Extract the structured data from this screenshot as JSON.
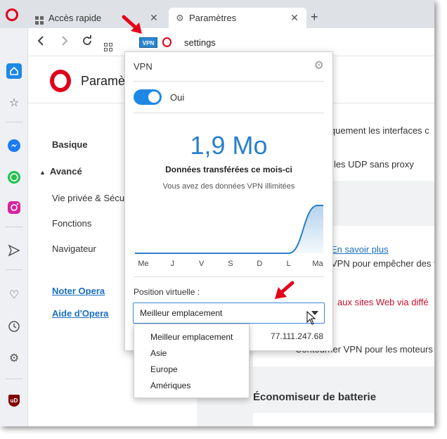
{
  "tabs": [
    {
      "title": "Accès rapide",
      "icon": "grid-icon"
    },
    {
      "title": "Paramètres",
      "icon": "gear-icon"
    }
  ],
  "address": {
    "vpn_badge": "VPN",
    "url": "settings"
  },
  "sidebar": {
    "items": [
      "home-icon",
      "star-icon",
      "messenger-icon",
      "whatsapp-icon",
      "instagram-icon",
      "send-icon",
      "heart-icon",
      "clock-icon",
      "gear-icon",
      "ublock-icon"
    ],
    "ublock_label": "uD"
  },
  "settings": {
    "title": "Paramèt",
    "nav": {
      "basic": "Basique",
      "advanced": "Avancé",
      "privacy": "Vie privée & Sécu",
      "features": "Fonctions",
      "browser": "Navigateur",
      "rate": "Noter Opera",
      "help": "Aide d'Opera"
    },
    "content": {
      "line1": "iquement les interfaces c",
      "line2": "r les UDP sans proxy",
      "learn_more": "En savoir plus",
      "line3": "VPN pour empêcher des t",
      "line4": "aux sites Web via diffé",
      "line5": "Contourner VPN pour les moteurs",
      "battery_title": "Économiseur de batterie"
    }
  },
  "vpn": {
    "title": "VPN",
    "toggle_label": "Oui",
    "amount": "1,9 Mo",
    "caption": "Données transférées ce mois-ci",
    "subcaption": "Vous avez des données VPN illimitées",
    "position_label": "Position virtuelle :",
    "selected": "Meilleur emplacement",
    "ip": "77.111.247.68",
    "options": [
      "Meilleur emplacement",
      "Asie",
      "Europe",
      "Amériques"
    ]
  },
  "chart_data": {
    "type": "area",
    "categories": [
      "Me",
      "J",
      "V",
      "S",
      "D",
      "L",
      "Ma"
    ],
    "values": [
      0,
      0,
      0,
      0,
      0,
      0,
      1.9
    ],
    "ylim": [
      0,
      1.9
    ],
    "color": "#2a7fc9"
  },
  "colors": {
    "accent": "#1e88e5",
    "opera_red": "#e0001a",
    "annotation_red": "#e3001b"
  }
}
